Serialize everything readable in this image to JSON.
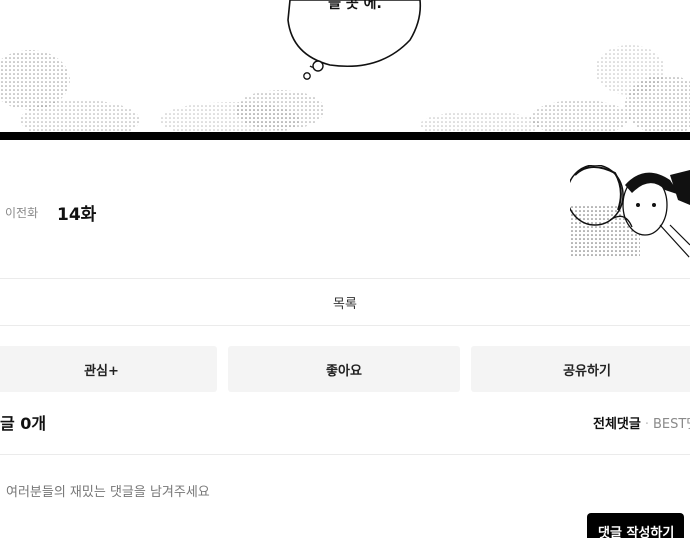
{
  "comic": {
    "bubble_text": "늘 곳 에."
  },
  "episode": {
    "prev_label": "이전화",
    "title": "14화"
  },
  "nav": {
    "list_label": "목록"
  },
  "actions": {
    "interest_label": "관심+",
    "like_label": "좋아요",
    "share_label": "공유하기"
  },
  "comments": {
    "count_label": "글 0개",
    "sort_all": "전체댓글",
    "sort_separator": "·",
    "sort_best": "BEST댓",
    "placeholder": "여러분들의 재밌는 댓글을 남겨주세요",
    "write_label": "댓글 작성하기"
  },
  "colors": {
    "accent": "#000000",
    "button_bg": "#f4f4f4",
    "muted_text": "#8a8a8a"
  }
}
